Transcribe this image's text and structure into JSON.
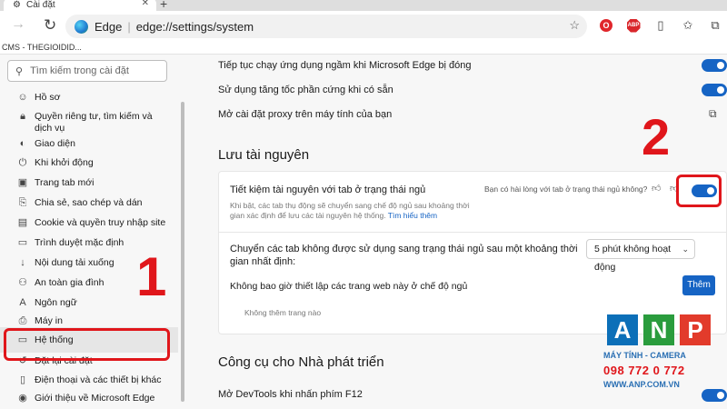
{
  "browser": {
    "tab_title": "Cài đặt",
    "tab_close": "✕",
    "new_tab": "+",
    "url_brand": "Edge",
    "url_separator": "|",
    "url": "edge://settings/system",
    "bookmarks_bar": "CMS - THEGIOIDID..."
  },
  "sidebar": {
    "search_placeholder": "Tìm kiếm trong cài đặt",
    "items": [
      {
        "label": "Hồ sơ",
        "icon": "user-icon"
      },
      {
        "label": "Quyền riêng tư, tìm kiếm và dịch vụ",
        "icon": "lock-icon"
      },
      {
        "label": "Giao diện",
        "icon": "appearance-icon"
      },
      {
        "label": "Khi khởi động",
        "icon": "power-icon"
      },
      {
        "label": "Trang tab mới",
        "icon": "new-tab-icon"
      },
      {
        "label": "Chia sẻ, sao chép và dán",
        "icon": "share-icon"
      },
      {
        "label": "Cookie và quyền truy nhập site",
        "icon": "cookie-icon"
      },
      {
        "label": "Trình duyệt mặc định",
        "icon": "browser-icon"
      },
      {
        "label": "Nội dung tải xuống",
        "icon": "download-icon"
      },
      {
        "label": "An toàn gia đình",
        "icon": "family-icon"
      },
      {
        "label": "Ngôn ngữ",
        "icon": "language-icon"
      },
      {
        "label": "Máy in",
        "icon": "printer-icon"
      },
      {
        "label": "Hệ thống",
        "icon": "system-icon",
        "active": true
      },
      {
        "label": "Đặt lại cài đặt",
        "icon": "reset-icon"
      },
      {
        "label": "Điện thoại và các thiết bị khác",
        "icon": "phone-icon"
      },
      {
        "label": "Giới thiệu về Microsoft Edge",
        "icon": "edge-icon"
      }
    ]
  },
  "main": {
    "rows_top": [
      {
        "label": "Tiếp tục chạy ứng dụng ngầm khi Microsoft Edge bị đóng",
        "control": "toggle",
        "on": true
      },
      {
        "label": "Sử dụng tăng tốc phần cứng khi có sẵn",
        "control": "toggle",
        "on": true
      },
      {
        "label": "Mở cài đặt proxy trên máy tính của bạn",
        "control": "external-link"
      }
    ],
    "section_resources": "Lưu tài nguyên",
    "card": {
      "title": "Tiết kiệm tài nguyên với tab ở trạng thái ngủ",
      "desc": "Khi bật, các tab thụ động sẽ chuyển sang chế độ ngủ sau khoảng thời gian xác định để lưu các tài nguyên hệ thống.",
      "link": "Tìm hiểu thêm",
      "feedback": "Bạn có hài lòng với tab ở trạng thái ngủ không?",
      "toggle_on": true,
      "sleep_label": "Chuyển các tab không được sử dụng sang trạng thái ngủ sau một khoảng thời gian nhất định:",
      "sleep_value": "5 phút không hoạt động",
      "never_sleep_label": "Không bao giờ thiết lập các trang web này ở chế độ ngủ",
      "add_button": "Thêm",
      "empty_text": "Không thêm trang nào"
    },
    "section_dev": "Công cụ cho Nhà phát triển",
    "dev_row": {
      "label": "Mở DevTools khi nhấn phím F12",
      "on": true
    }
  },
  "annotations": {
    "step1": "1",
    "step2": "2"
  },
  "watermark": {
    "letters": [
      "A",
      "N",
      "P"
    ],
    "line1": "MÁY TÍNH - CAMERA",
    "phone": "098 772 0 772",
    "web": "WWW.ANP.COM.VN"
  },
  "colors": {
    "accent": "#1664c4",
    "annotation": "#e0161b"
  }
}
